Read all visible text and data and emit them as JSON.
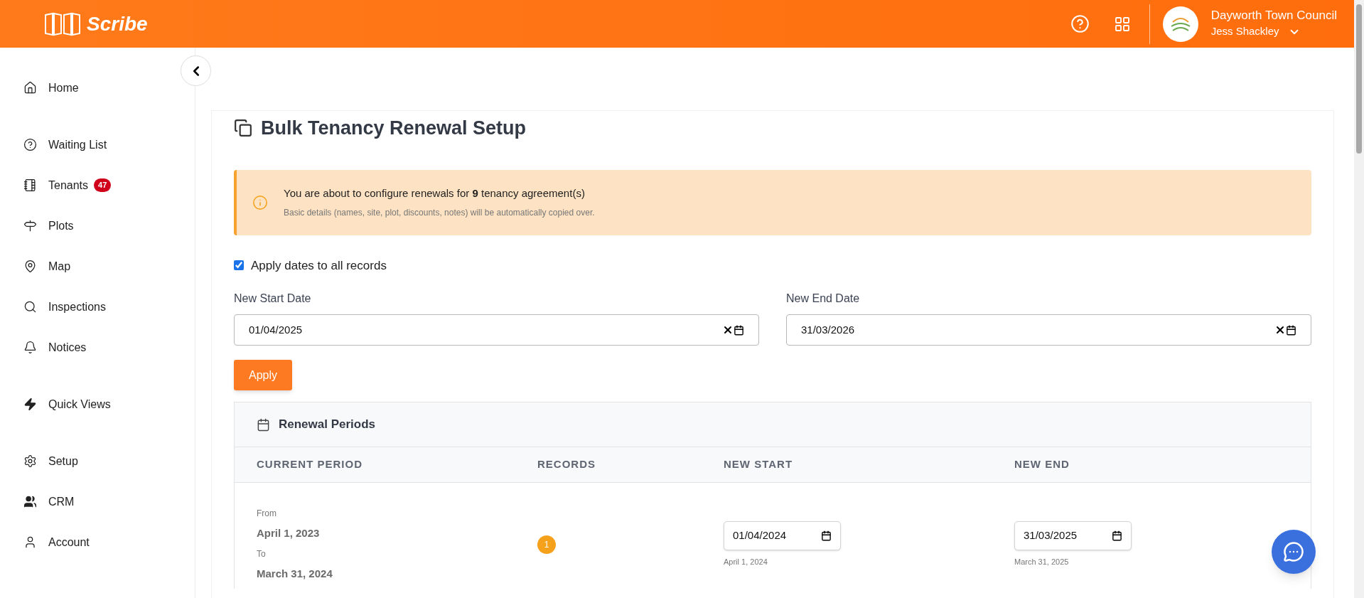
{
  "header": {
    "logo": "Scribe",
    "organisation": "Dayworth Town Council",
    "user": "Jess Shackley"
  },
  "sidebar": {
    "sections": [
      [
        {
          "label": "Home"
        }
      ],
      [
        {
          "label": "Waiting List"
        },
        {
          "label": "Tenants",
          "badge": "47"
        },
        {
          "label": "Plots"
        },
        {
          "label": "Map"
        },
        {
          "label": "Inspections"
        },
        {
          "label": "Notices"
        }
      ],
      [
        {
          "label": "Quick Views"
        }
      ],
      [
        {
          "label": "Setup"
        },
        {
          "label": "CRM"
        },
        {
          "label": "Account"
        }
      ]
    ]
  },
  "page": {
    "title": "Bulk Tenancy Renewal Setup"
  },
  "alert": {
    "message": "You are about to configure renewals for **9** tenancy agreement(s)",
    "detail": "Basic details (names, site, plot, discounts, notes) will be automatically copied over."
  },
  "apply_all": {
    "label": "Apply dates to all records",
    "checked": true
  },
  "date_fields": [
    {
      "label": "New Start Date",
      "value": "01/04/2025"
    },
    {
      "label": "New End Date",
      "value": "31/03/2026"
    }
  ],
  "apply_button": "Apply",
  "renewal_periods": {
    "title": "Renewal Periods",
    "columns": [
      "CURRENT PERIOD",
      "RECORDS",
      "NEW START",
      "NEW END"
    ],
    "rows": [
      {
        "from_label": "From",
        "from": "April 1, 2023",
        "to_label": "To",
        "to": "March 31, 2024",
        "records": "1",
        "new_start": "01/04/2024",
        "new_start_hint": "April 1, 2024",
        "new_end": "31/03/2025",
        "new_end_hint": "March 31, 2025"
      }
    ]
  }
}
